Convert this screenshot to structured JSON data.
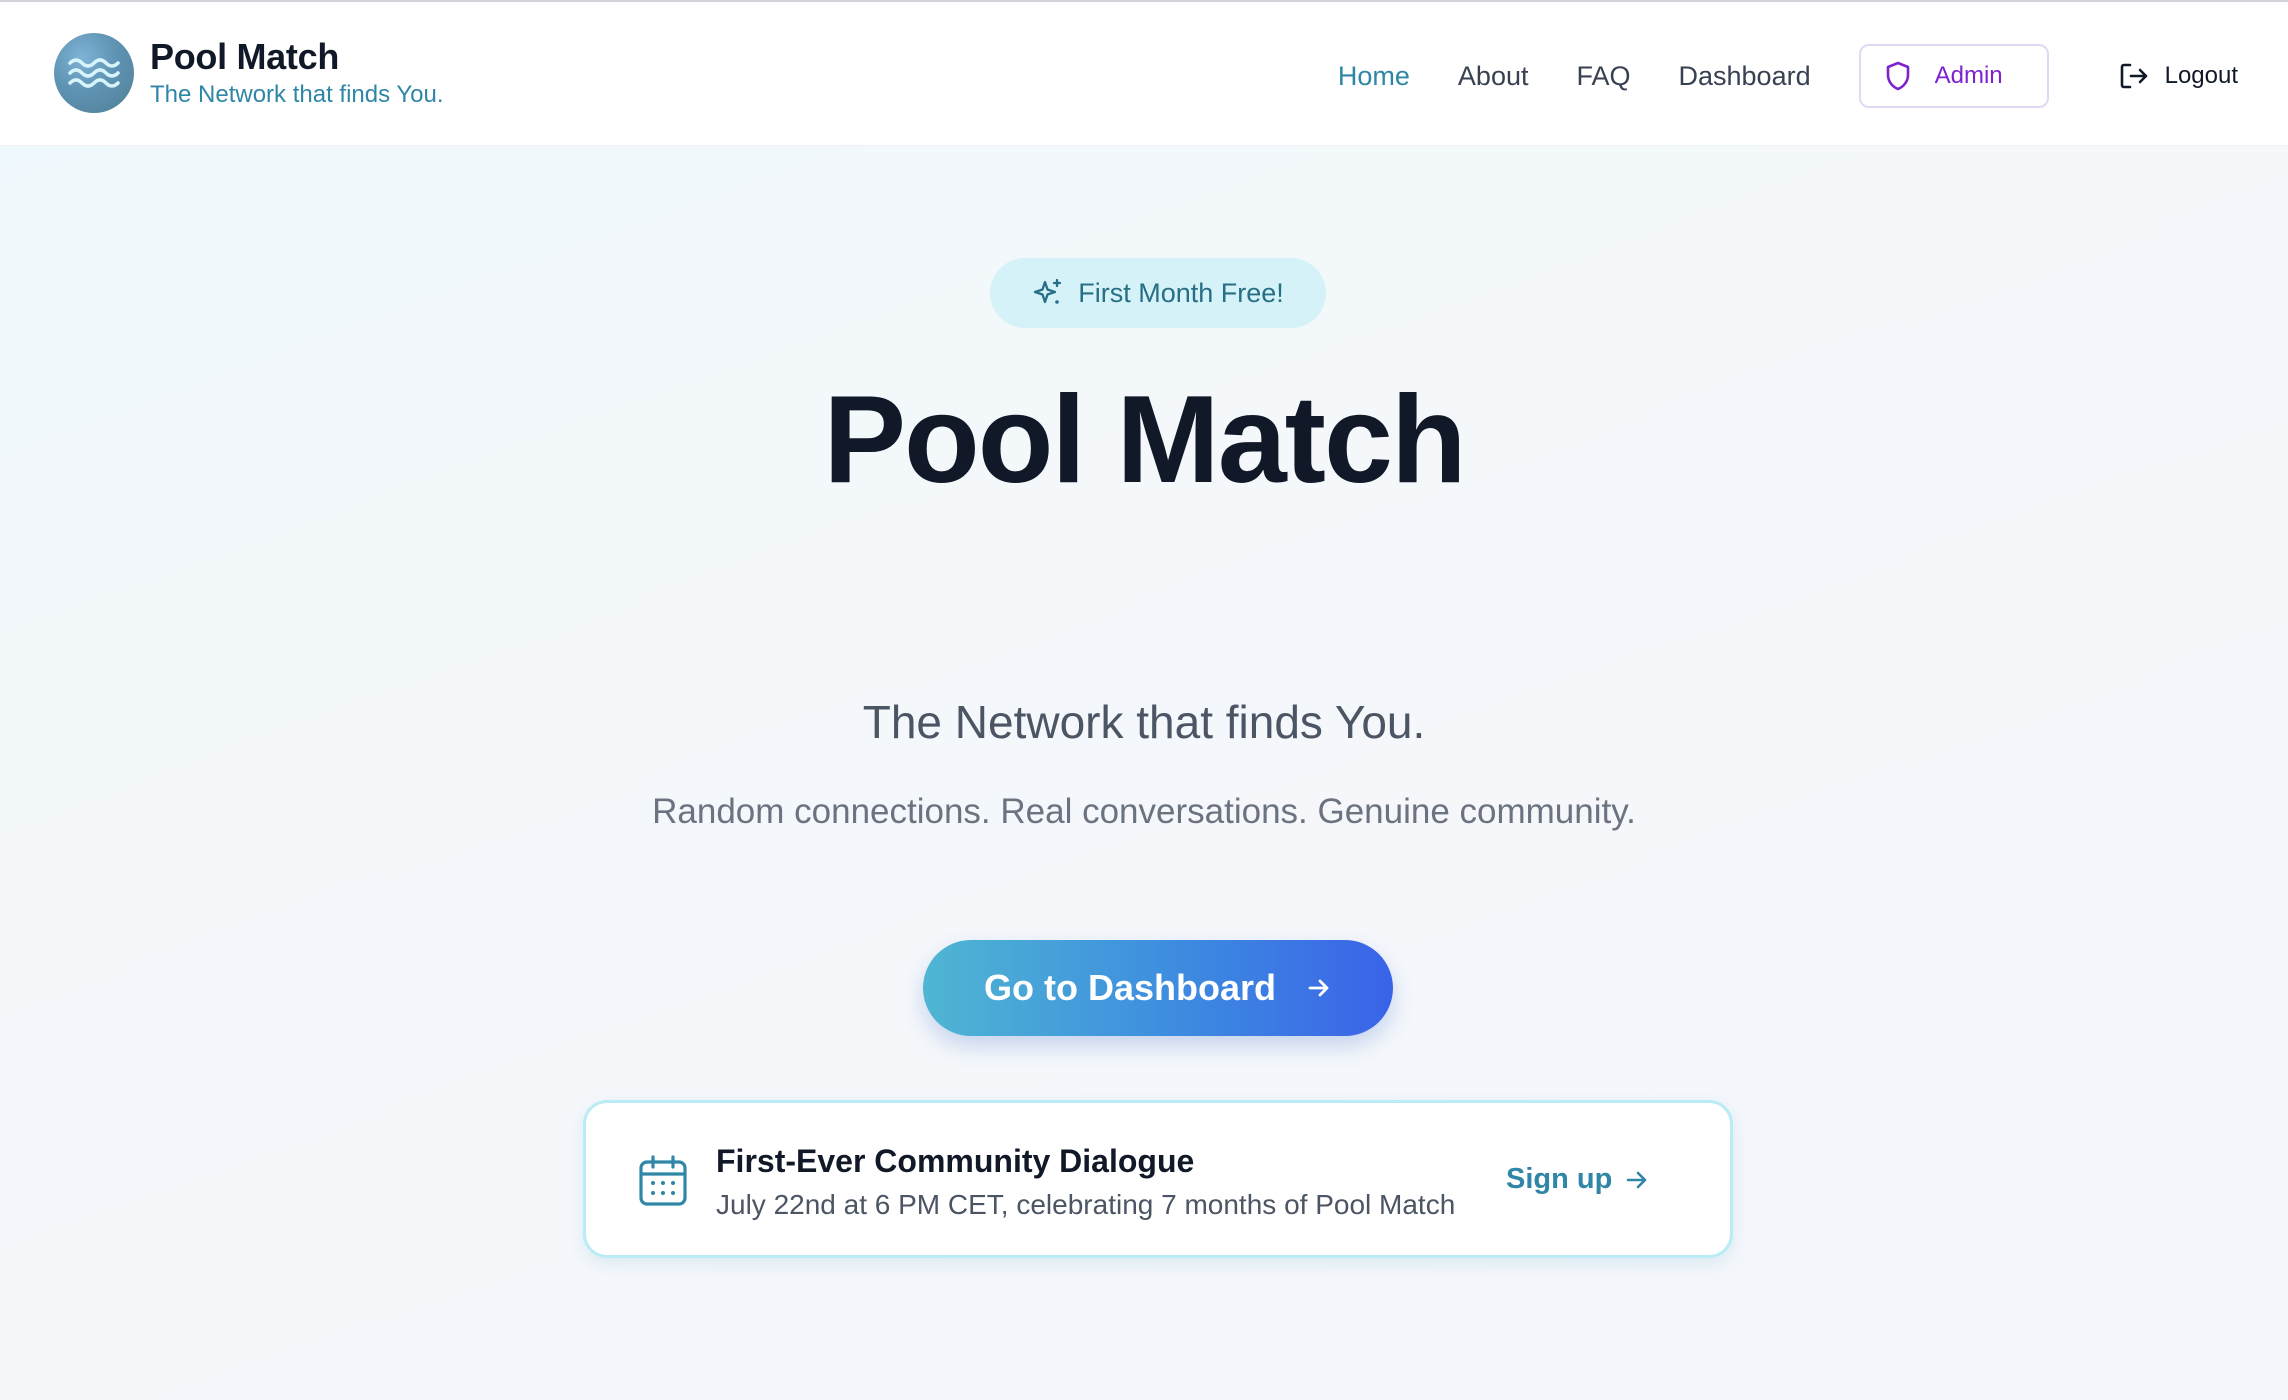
{
  "brand": {
    "title": "Pool Match",
    "tagline": "The Network that finds You.",
    "logo_icon": "waves-icon"
  },
  "nav": {
    "items": [
      {
        "label": "Home",
        "active": true
      },
      {
        "label": "About",
        "active": false
      },
      {
        "label": "FAQ",
        "active": false
      },
      {
        "label": "Dashboard",
        "active": false
      }
    ],
    "admin": {
      "label": "Admin",
      "icon": "shield-icon"
    },
    "logout": {
      "label": "Logout",
      "icon": "logout-icon"
    }
  },
  "hero": {
    "badge": {
      "label": "First Month Free!",
      "icon": "sparkles-icon"
    },
    "title": "Pool Match",
    "subtitle": "The Network that finds You.",
    "description": "Random connections. Real conversations. Genuine community.",
    "cta": {
      "label": "Go to Dashboard",
      "icon": "arrow-right-icon"
    }
  },
  "event": {
    "icon": "calendar-icon",
    "title": "First-Ever Community Dialogue",
    "detail": "July 22nd at 6 PM CET, celebrating 7 months of Pool Match",
    "action": {
      "label": "Sign up",
      "icon": "arrow-right-icon"
    }
  },
  "colors": {
    "accent": "#2f86a6",
    "admin": "#7e22ce",
    "cta_start": "#4fb6d2",
    "cta_end": "#3a63e8",
    "badge_bg": "#d4f2f8"
  }
}
